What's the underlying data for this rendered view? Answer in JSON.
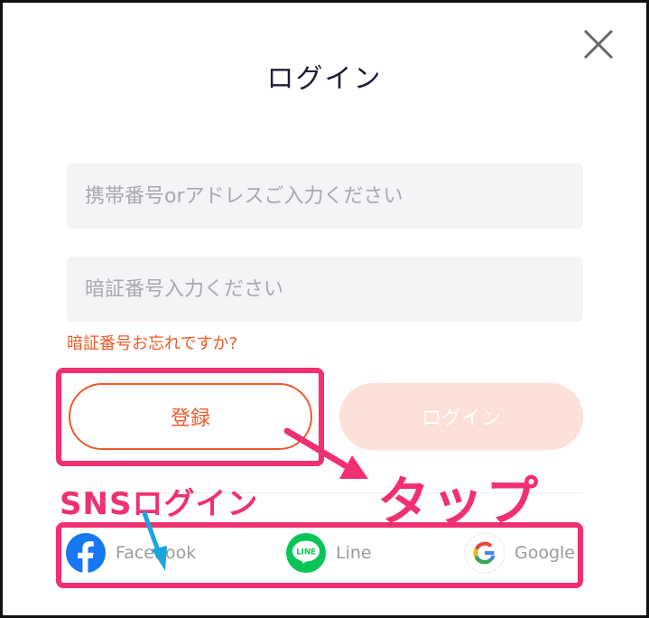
{
  "dialog": {
    "title": "ログイン",
    "close_icon": "close-icon"
  },
  "form": {
    "account_placeholder": "携帯番号orアドレスご入力ください",
    "password_placeholder": "暗証番号入力ください",
    "forgot_link": "暗証番号お忘れですか?"
  },
  "buttons": {
    "register": "登録",
    "login": "ログイン"
  },
  "sns": {
    "items": [
      {
        "label": "Facebook",
        "icon": "facebook-icon"
      },
      {
        "label": "Line",
        "icon": "line-icon",
        "icon_text": "LINE"
      },
      {
        "label": "Google",
        "icon": "google-icon"
      }
    ]
  },
  "annotations": {
    "sns_label": "SNSログイン",
    "tap_label": "タップ"
  },
  "colors": {
    "accent": "#f05a28",
    "login_disabled": "#fde0d8",
    "highlight": "#f0306f",
    "arrow_blue": "#17a6e0",
    "facebook": "#1877f2",
    "line": "#06c755"
  }
}
